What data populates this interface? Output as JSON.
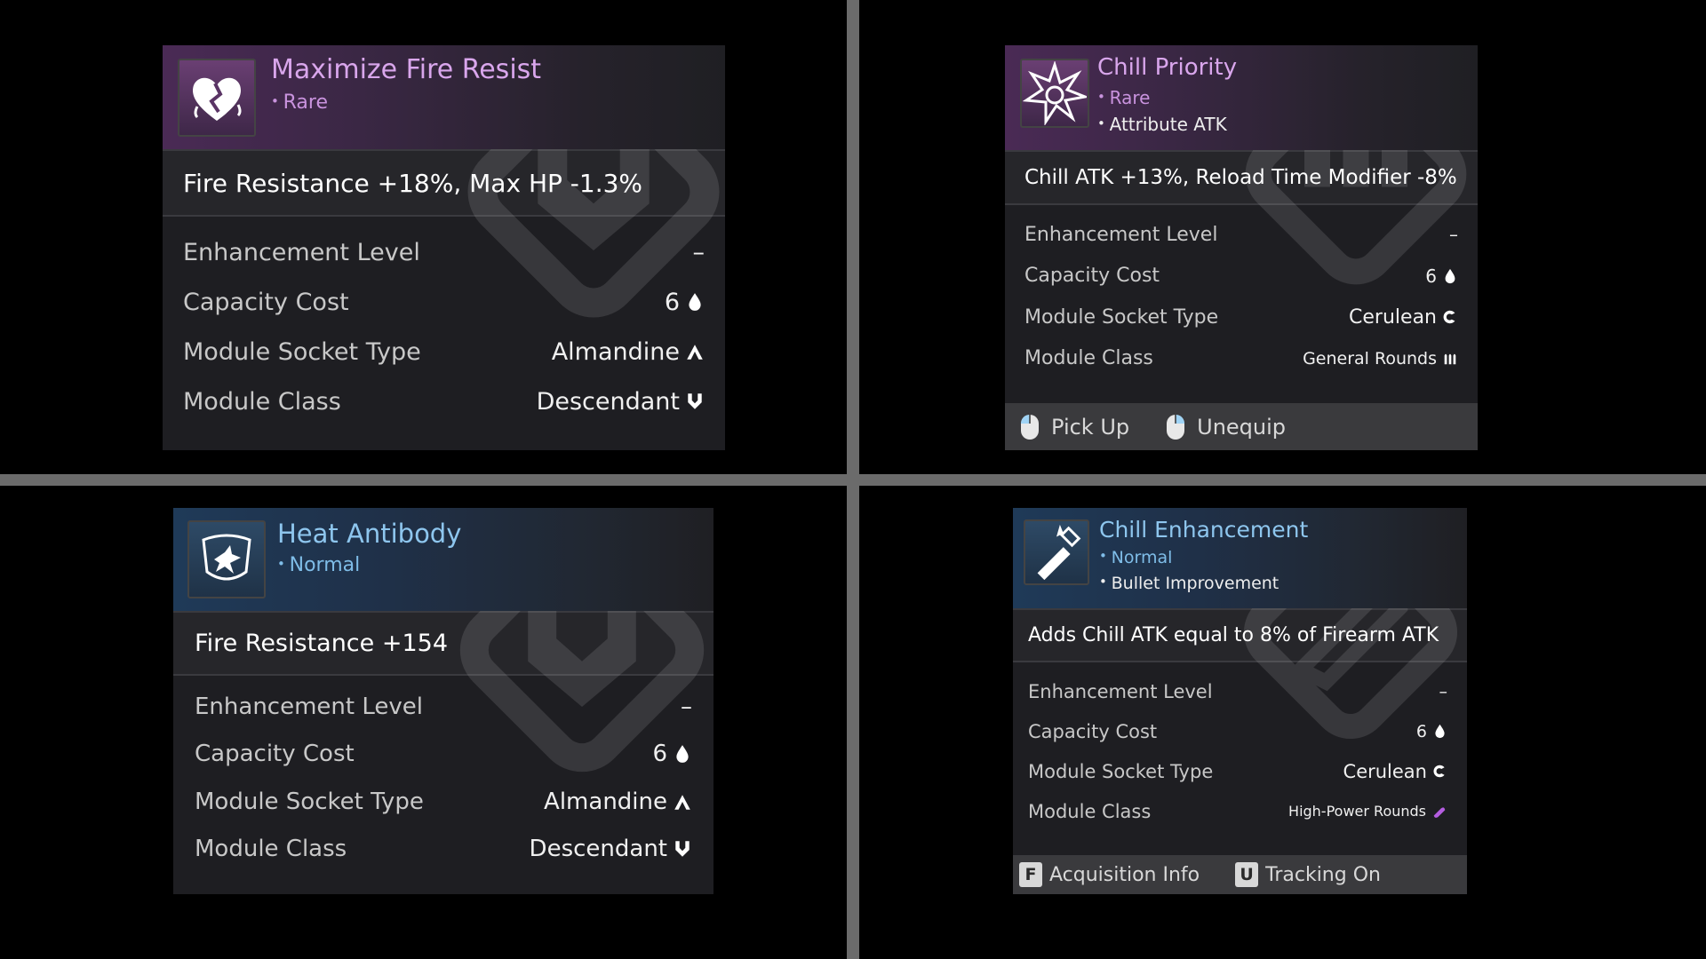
{
  "cards": [
    {
      "title": "Maximize Fire Resist",
      "grade": "Rare",
      "effect": "Fire Resistance +18%, Max HP -1.3%",
      "icon": "broken-heart-icon",
      "stats": [
        {
          "label": "Enhancement Level",
          "value": "–",
          "icon": ""
        },
        {
          "label": "Capacity Cost",
          "value": "6",
          "icon": "drop-icon"
        },
        {
          "label": "Module Socket Type",
          "value": "Almandine",
          "icon": "almandine-socket-icon"
        },
        {
          "label": "Module Class",
          "value": "Descendant",
          "icon": "descendant-class-icon"
        }
      ]
    },
    {
      "title": "Chill Priority",
      "grade": "Rare",
      "kind": "Attribute ATK",
      "effect": "Chill ATK +13%, Reload Time Modifier -8%",
      "icon": "burst-icon",
      "stats": [
        {
          "label": "Enhancement Level",
          "value": "–",
          "icon": ""
        },
        {
          "label": "Capacity Cost",
          "value": "6",
          "icon": "drop-icon"
        },
        {
          "label": "Module Socket Type",
          "value": "Cerulean",
          "icon": "cerulean-socket-icon"
        },
        {
          "label": "Module Class",
          "value": "General Rounds",
          "icon": "general-rounds-icon"
        }
      ],
      "footer": [
        {
          "label": "Pick Up",
          "icon": "mouse-left-icon"
        },
        {
          "label": "Unequip",
          "icon": "mouse-right-icon"
        }
      ]
    },
    {
      "title": "Heat Antibody",
      "grade": "Normal",
      "effect": "Fire Resistance +154",
      "icon": "shield-body-icon",
      "stats": [
        {
          "label": "Enhancement Level",
          "value": "–",
          "icon": ""
        },
        {
          "label": "Capacity Cost",
          "value": "6",
          "icon": "drop-icon"
        },
        {
          "label": "Module Socket Type",
          "value": "Almandine",
          "icon": "almandine-socket-icon"
        },
        {
          "label": "Module Class",
          "value": "Descendant",
          "icon": "descendant-class-icon"
        }
      ]
    },
    {
      "title": "Chill Enhancement",
      "grade": "Normal",
      "kind": "Bullet Improvement",
      "effect": "Adds Chill ATK equal to 8% of Firearm ATK",
      "icon": "syringe-icon",
      "stats": [
        {
          "label": "Enhancement Level",
          "value": "–",
          "icon": ""
        },
        {
          "label": "Capacity Cost",
          "value": "6",
          "icon": "drop-icon"
        },
        {
          "label": "Module Socket Type",
          "value": "Cerulean",
          "icon": "cerulean-socket-icon"
        },
        {
          "label": "Module Class",
          "value": "High-Power Rounds",
          "icon": "high-power-rounds-icon"
        }
      ],
      "footer": [
        {
          "key": "F",
          "label": "Acquisition Info"
        },
        {
          "key": "U",
          "label": "Tracking On"
        }
      ]
    }
  ],
  "colors": {
    "rare": "#d9a6ec",
    "normal": "#8ec6ee",
    "high_power": "#b45de0",
    "mouse_highlight": "#9fd3f5"
  }
}
